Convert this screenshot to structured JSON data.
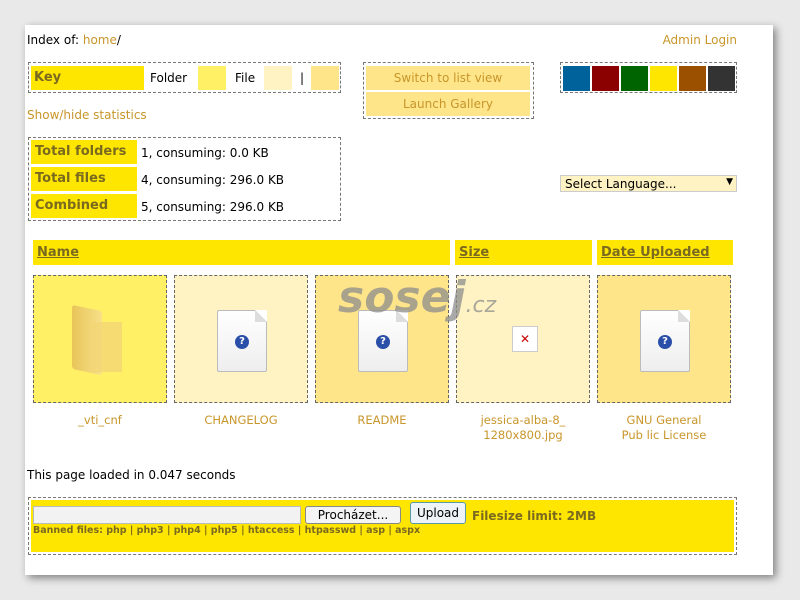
{
  "breadcrumb": {
    "prefix": "Index of: ",
    "home": "home",
    "sep": "/"
  },
  "admin_login": "Admin Login",
  "key": {
    "title": "Key",
    "folder": "Folder",
    "file": "File",
    "sep": "|"
  },
  "buttons": {
    "list_view": "Switch to list view",
    "gallery": "Launch Gallery"
  },
  "theme_colors": [
    "#00629b",
    "#8b0000",
    "#006400",
    "#ffe600",
    "#9b5000",
    "#333333"
  ],
  "show_hide": "Show/hide statistics",
  "stats": [
    {
      "label": "Total folders",
      "value": "1, consuming: 0.0 KB"
    },
    {
      "label": "Total files",
      "value": "4, consuming: 296.0 KB"
    },
    {
      "label": "Combined",
      "value": "5, consuming: 296.0 KB"
    }
  ],
  "language": {
    "selected": "Select Language..."
  },
  "columns": {
    "name": "Name",
    "size": "Size",
    "date": "Date Uploaded"
  },
  "items": [
    {
      "name": "_vti_cnf",
      "type": "folder",
      "color": "#fff066"
    },
    {
      "name": "CHANGELOG",
      "type": "file",
      "color": "#fff3c4"
    },
    {
      "name": "README",
      "type": "file",
      "color": "#ffe58a"
    },
    {
      "name": "jessica-alba-8_ 1280x800.jpg",
      "type": "image-broken",
      "color": "#fff3c4"
    },
    {
      "name": "GNU General Pub lic License",
      "type": "file",
      "color": "#ffe58a"
    }
  ],
  "watermark": "sosej.cz",
  "load_time": "This page loaded in 0.047 seconds",
  "upload": {
    "browse": "Procházet...",
    "upload": "Upload",
    "limit": "Filesize limit: 2MB",
    "banned": "Banned files: php | php3 | php4 | php5 | htaccess | htpasswd | asp | aspx"
  }
}
